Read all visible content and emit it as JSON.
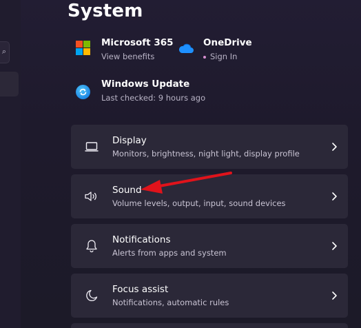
{
  "page": {
    "title": "System"
  },
  "tiles": [
    {
      "title": "Microsoft 365",
      "subtitle": "View benefits",
      "icon": "microsoft-logo-icon"
    },
    {
      "title": "OneDrive",
      "subtitle": "Sign In",
      "icon": "onedrive-cloud-icon"
    },
    {
      "title": "Windows Update",
      "subtitle": "Last checked: 9 hours ago",
      "icon": "windows-update-icon"
    }
  ],
  "settings": [
    {
      "label": "Display",
      "description": "Monitors, brightness, night light, display profile",
      "icon": "monitor-icon"
    },
    {
      "label": "Sound",
      "description": "Volume levels, output, input, sound devices",
      "icon": "speaker-icon"
    },
    {
      "label": "Notifications",
      "description": "Alerts from apps and system",
      "icon": "bell-icon"
    },
    {
      "label": "Focus assist",
      "description": "Notifications, automatic rules",
      "icon": "moon-icon"
    }
  ],
  "colors": {
    "ms_red": "#f25022",
    "ms_green": "#7fba00",
    "ms_blue": "#00a4ef",
    "ms_yellow": "#ffb900",
    "onedrive_blue": "#1e90ff",
    "annotation_arrow": "#e0131b"
  }
}
